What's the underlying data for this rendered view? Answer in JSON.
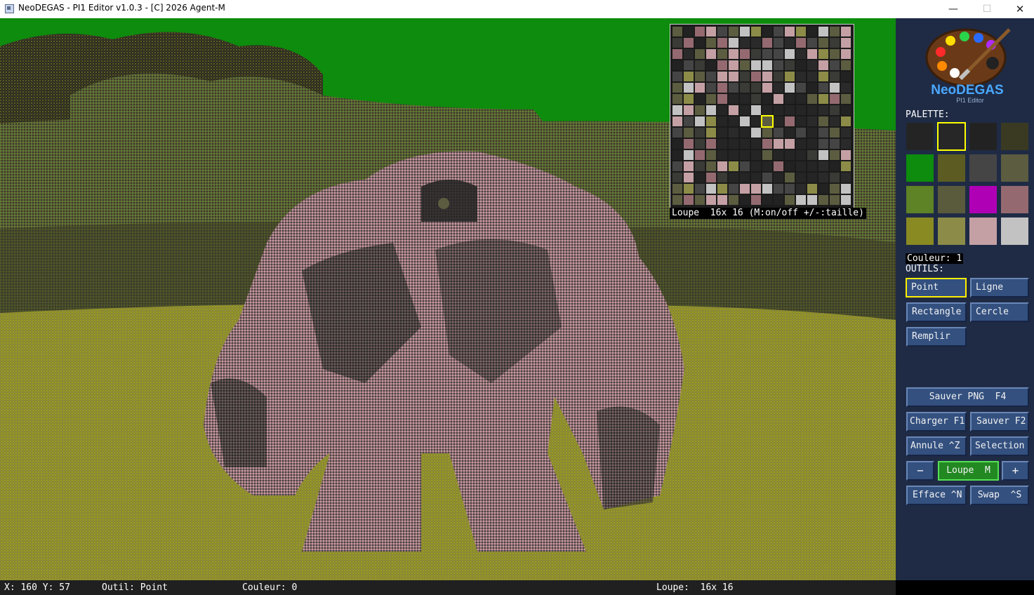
{
  "window": {
    "title": "NeoDEGAS - PI1 Editor v1.0.3 - [C] 2026 Agent-M",
    "minimize": "—",
    "maximize": "☐",
    "close": "✕"
  },
  "loupe": {
    "caption": "Loupe  16x 16 (M:on/off +/-:taille)"
  },
  "sidebar": {
    "logo_text": "NeoDEGAS",
    "logo_subtext": "PI1 Editor",
    "palette_label": "PALETTE:",
    "palette": [
      "#242424",
      "#272727",
      "#222222",
      "#3a3a22",
      "#0d8c0d",
      "#5c5c22",
      "#454545",
      "#5c5c40",
      "#5e8226",
      "#5a5a3c",
      "#b000b6",
      "#946a70",
      "#8a8a22",
      "#8c8c48",
      "#c4a0a4",
      "#c2c2c2"
    ],
    "selected_color": 1,
    "couleur_label": "Couleur: 1",
    "outils_label": "OUTILS:",
    "tools": [
      "Point",
      "Ligne",
      "Rectangle",
      "Cercle",
      "Remplir"
    ],
    "active_tool": "Point",
    "buttons": {
      "save_png": "Sauver PNG  F4",
      "load": "Charger F1",
      "save": "Sauver F2",
      "undo": "Annule ^Z",
      "selection": "Selection",
      "minus": "−",
      "loupe": "Loupe  M",
      "plus": "+",
      "clear": "Efface ^N",
      "swap": "Swap  ^S"
    }
  },
  "status": {
    "coords": "X: 160 Y: 57",
    "tool": "Outil: Point",
    "color": "Couleur: 0",
    "loupe": "Loupe:  16x 16"
  }
}
